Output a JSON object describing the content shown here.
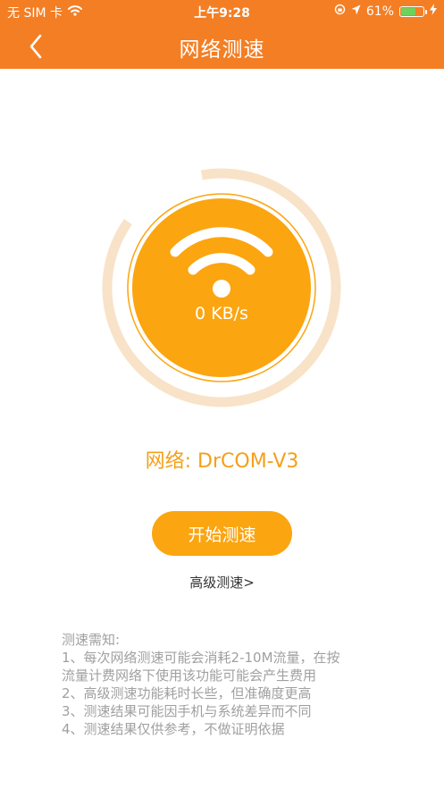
{
  "status_bar": {
    "carrier": "无 SIM 卡",
    "time": "上午9:28",
    "battery_percent": "61%",
    "battery_level": 0.61
  },
  "nav": {
    "title": "网络测速",
    "back_icon": "chevron-left-icon"
  },
  "gauge": {
    "speed_text": "0 KB/s",
    "icon": "wifi-icon",
    "colors": {
      "fill": "#fba510",
      "ring": "#fba510",
      "track": "#f8e3c8"
    }
  },
  "network": {
    "text": "网络: DrCOM-V3"
  },
  "actions": {
    "start_label": "开始测速",
    "advanced_label": "高级测速>"
  },
  "notes": {
    "title": "测速需知:",
    "lines": [
      "1、每次网络测速可能会消耗2-10M流量，在按",
      "流量计费网络下使用该功能可能会产生费用",
      "2、高级测速功能耗时长些，但准确度更高",
      "3、测速结果可能因手机与系统差异而不同",
      "4、测速结果仅供参考，不做证明依据"
    ]
  },
  "colors": {
    "accent": "#f47e24",
    "button": "#fba510",
    "network_text": "#f4a018"
  }
}
